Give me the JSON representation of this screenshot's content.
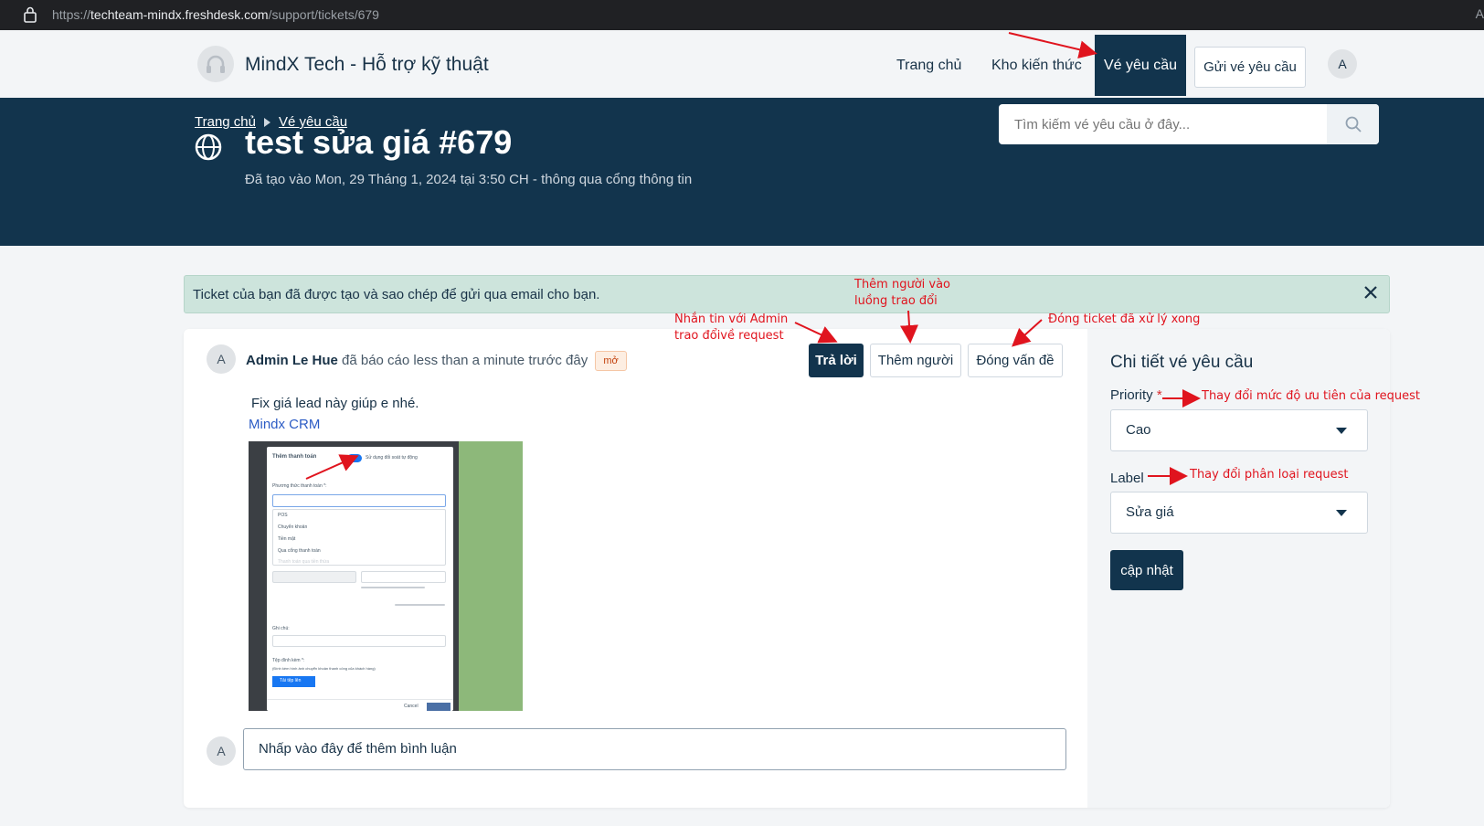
{
  "browser": {
    "url_prefix": "https://",
    "url_host": "techteam-mindx.freshdesk.com",
    "url_path": "/support/tickets/679",
    "edge_letter": "A"
  },
  "header": {
    "brand": "MindX Tech - Hỗ trợ kỹ thuật",
    "nav": {
      "home": "Trang chủ",
      "knowledge": "Kho kiến thức",
      "tickets": "Vé yêu cầu",
      "submit": "Gửi vé yêu cầu"
    },
    "avatar": "A"
  },
  "banner": {
    "breadcrumb": [
      "Trang chủ",
      "Vé yêu cầu"
    ],
    "title": "test sửa giá #679",
    "meta": "Đã tạo vào Mon, 29 Tháng 1, 2024 tại 3:50 CH - thông qua cổng thông tin",
    "search_placeholder": "Tìm kiếm vé yêu cầu ở đây..."
  },
  "alert": {
    "message": "Ticket của bạn đã được tạo và sao chép để gửi qua email cho bạn."
  },
  "conversation": {
    "avatar": "A",
    "reporter_name": "Admin Le Hue",
    "reporter_action": " đã báo cáo less than a minute trước đây",
    "status": "mở",
    "actions": {
      "reply": "Trả lời",
      "add_people": "Thêm người",
      "close": "Đóng vấn đề"
    },
    "body_text": "Fix giá lead này giúp e nhé.",
    "body_link": "Mindx CRM",
    "comment_avatar": "A",
    "comment_placeholder": "Nhấp vào đây để thêm bình luận"
  },
  "screenshot_thumb": {
    "modal_title": "Thêm thanh toán",
    "toggle_label": "Sử dụng đối soát tự động",
    "method_label": "Phương thức thanh toán *:",
    "options": [
      "POS",
      "Chuyển khoản",
      "Tiền mặt",
      "Qua cổng thanh toán",
      "Thanh toán qua tiền thừa"
    ],
    "note_label": "Ghi chú:",
    "attach_label": "Tệp đính kèm *:",
    "attach_hint": "(Đính kèm hình ảnh chuyển khoản thanh công của khách hàng)",
    "upload_button": "Tải tệp lên",
    "cancel_button": "Cancel"
  },
  "details": {
    "title": "Chi tiết vé yêu cầu",
    "priority_label": "Priority",
    "required_mark": "*",
    "priority_value": "Cao",
    "label_label": "Label",
    "label_value": "Sửa giá",
    "update_button": "cập nhật"
  },
  "annotations": {
    "add_person": [
      "Thêm người vào",
      "luồng trao đổi"
    ],
    "message_admin": [
      "Nhắn tin với Admin",
      "trao đổivề request"
    ],
    "close_ticket": "Đóng ticket đã xử lý xong",
    "change_priority": "Thay đổi mức độ ưu tiên của request",
    "change_label": "Thay đổi phân loại request"
  },
  "colors": {
    "brand_dark": "#12344d",
    "alert_bg": "#cde4dc",
    "annotation": "#e0141e"
  }
}
